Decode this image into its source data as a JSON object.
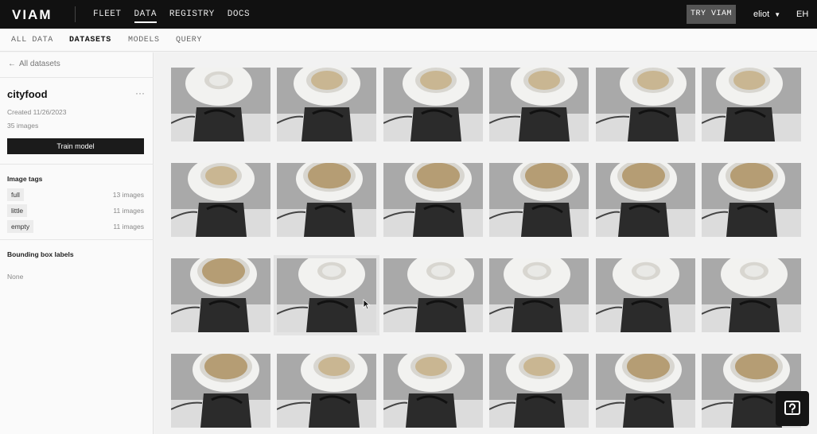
{
  "topbar": {
    "logo": "VIAM",
    "nav": [
      {
        "label": "FLEET",
        "active": false
      },
      {
        "label": "DATA",
        "active": true
      },
      {
        "label": "REGISTRY",
        "active": false
      },
      {
        "label": "DOCS",
        "active": false
      }
    ],
    "try_label": "TRY VIAM",
    "user": "eliot",
    "initials": "EH"
  },
  "subnav": [
    {
      "label": "ALL DATA",
      "active": false
    },
    {
      "label": "DATASETS",
      "active": true
    },
    {
      "label": "MODELS",
      "active": false
    },
    {
      "label": "QUERY",
      "active": false
    }
  ],
  "sidebar": {
    "back_label": "All datasets",
    "title": "cityfood",
    "more": "···",
    "created": "Created 11/26/2023",
    "count": "35 images",
    "train_label": "Train model",
    "tags_title": "Image tags",
    "tags": [
      {
        "name": "full",
        "count": "13 images"
      },
      {
        "name": "little",
        "count": "11 images"
      },
      {
        "name": "empty",
        "count": "11 images"
      }
    ],
    "bbox_title": "Bounding box labels",
    "bbox_none": "None"
  },
  "grid": {
    "rows": 4,
    "cols": 6,
    "fill": [
      [
        "empty",
        "little",
        "little",
        "little",
        "little",
        "little"
      ],
      [
        "little",
        "full",
        "full",
        "full",
        "full",
        "full"
      ],
      [
        "full",
        "empty",
        "empty",
        "empty",
        "empty",
        "empty"
      ],
      [
        "full",
        "little",
        "little",
        "little",
        "full",
        "full"
      ]
    ]
  },
  "colors": {
    "topbar": "#111111",
    "train_button": "#1b1b1b",
    "accent": "#ffffff"
  },
  "icons": {
    "back": "arrow-left-icon",
    "more": "more-horizontal-icon",
    "user_menu": "chevron-down-icon",
    "help": "help-chat-icon"
  }
}
